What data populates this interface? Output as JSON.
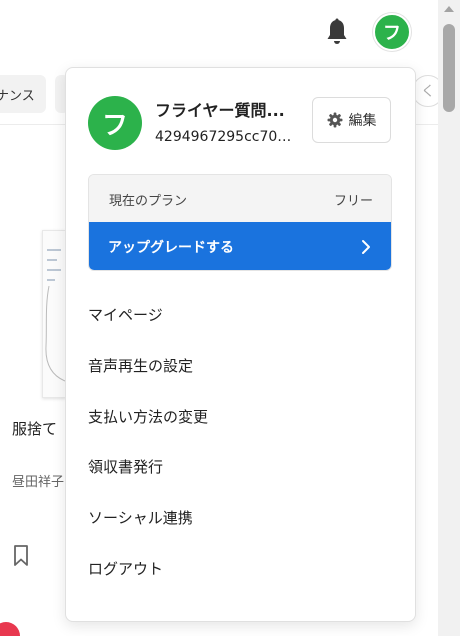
{
  "header": {
    "avatar_initial": "フ",
    "bell_icon": "bell-icon",
    "colors": {
      "avatar": "#2cb24b"
    }
  },
  "background": {
    "chip_1": "ナンス",
    "chip_circle_glyph": "く",
    "card_title": "服捨て",
    "card_author": "昼田祥子"
  },
  "dropdown": {
    "avatar_initial": "フ",
    "user_name": "フライヤー質問...",
    "user_id": "4294967295cc701...",
    "edit_label": "編集",
    "plan": {
      "label": "現在のプラン",
      "value": "フリー"
    },
    "upgrade_label": "アップグレードする",
    "items": [
      {
        "label": "マイページ"
      },
      {
        "label": "音声再生の設定"
      },
      {
        "label": "支払い方法の変更"
      },
      {
        "label": "領収書発行"
      },
      {
        "label": "ソーシャル連携"
      },
      {
        "label": "ログアウト"
      }
    ],
    "colors": {
      "accent": "#1a73de",
      "avatar": "#2cb24b"
    }
  }
}
